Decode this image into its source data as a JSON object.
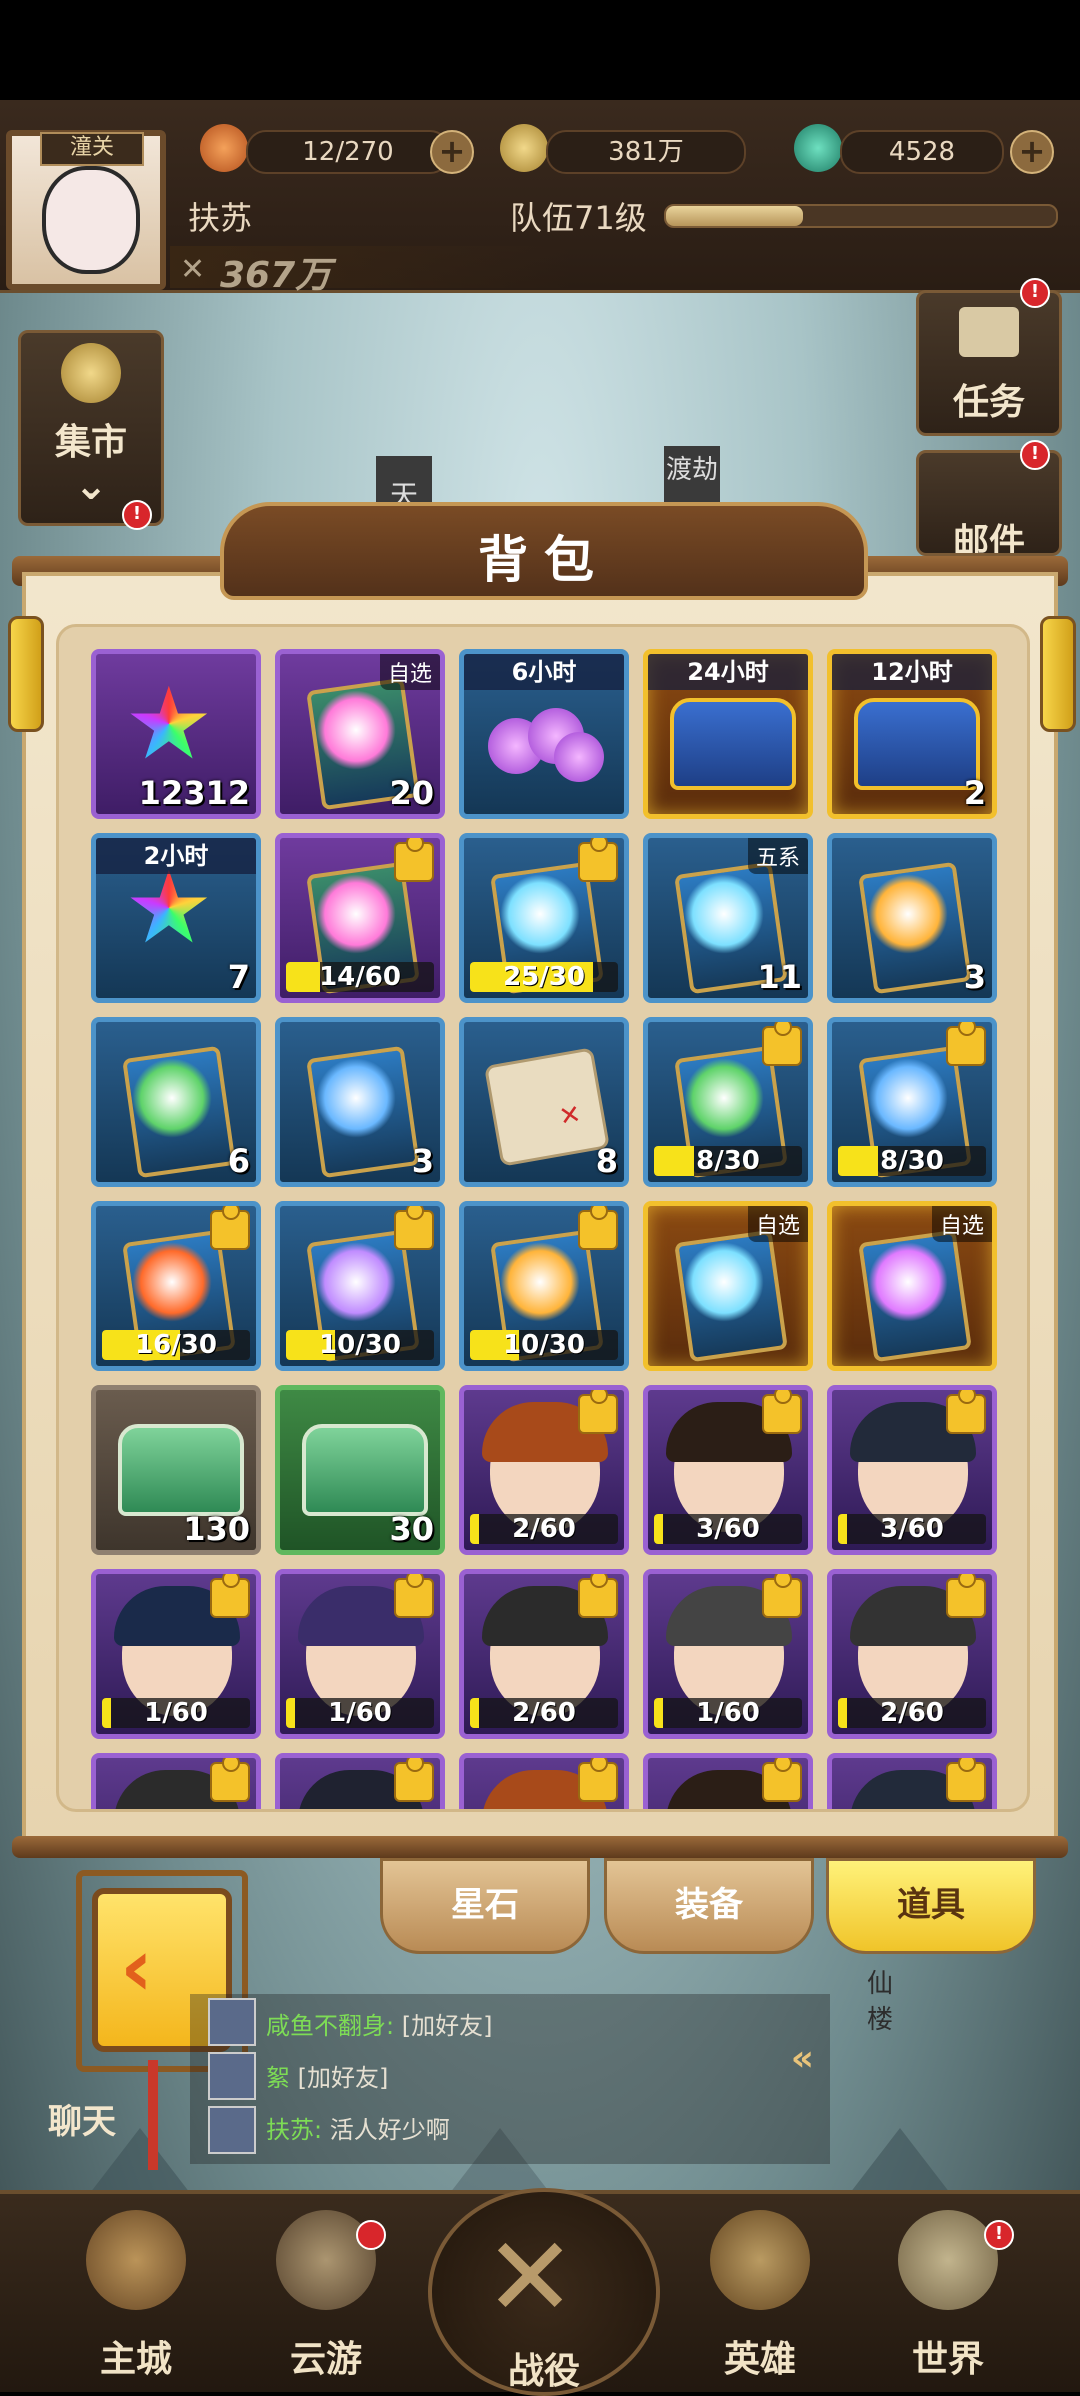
{
  "hud": {
    "avatar_tag": "潼关",
    "food": "12/270",
    "coins": "381万",
    "jade": "4528",
    "player_name": "扶苏",
    "team_level": "队伍71级",
    "team_level_progress": 0.35,
    "power": "367万"
  },
  "side": {
    "market": "集市",
    "task": "任务",
    "mail": "邮件",
    "sign_sky": "天",
    "sign_robbery": "渡劫",
    "tower": "仙楼"
  },
  "bag": {
    "title": "背包",
    "items": [
      {
        "quality": "purple",
        "kind": "star",
        "count": "12312"
      },
      {
        "quality": "purple",
        "kind": "card",
        "corner": "自选",
        "count": "20"
      },
      {
        "quality": "blue",
        "kind": "orbs",
        "band": "6小时"
      },
      {
        "quality": "gold",
        "kind": "chest",
        "band": "24小时"
      },
      {
        "quality": "gold",
        "kind": "bag",
        "band": "12小时",
        "count": "2"
      },
      {
        "quality": "blue",
        "kind": "star",
        "band": "2小时",
        "count": "7"
      },
      {
        "quality": "purple",
        "kind": "card-piece",
        "progress": "14/60",
        "fill": 0.233
      },
      {
        "quality": "blue",
        "kind": "card-piece",
        "progress": "25/30",
        "fill": 0.833
      },
      {
        "quality": "blue",
        "kind": "card",
        "corner": "五系",
        "count": "11"
      },
      {
        "quality": "blue",
        "kind": "card-gold",
        "count": "3"
      },
      {
        "quality": "blue",
        "kind": "card-green",
        "count": "6"
      },
      {
        "quality": "blue",
        "kind": "card-blue",
        "count": "3"
      },
      {
        "quality": "blue",
        "kind": "map",
        "count": "8"
      },
      {
        "quality": "blue",
        "kind": "card-piece-green",
        "progress": "8/30",
        "fill": 0.267
      },
      {
        "quality": "blue",
        "kind": "card-piece-blue",
        "progress": "8/30",
        "fill": 0.267
      },
      {
        "quality": "blue",
        "kind": "card-piece-fire",
        "progress": "16/30",
        "fill": 0.533
      },
      {
        "quality": "blue",
        "kind": "card-piece-moon",
        "progress": "10/30",
        "fill": 0.333
      },
      {
        "quality": "blue",
        "kind": "card-piece-sun",
        "progress": "10/30",
        "fill": 0.333
      },
      {
        "quality": "gold",
        "kind": "card",
        "corner": "自选"
      },
      {
        "quality": "gold",
        "kind": "card-purple",
        "corner": "自选"
      },
      {
        "quality": "gray",
        "kind": "chest-green",
        "count": "130"
      },
      {
        "quality": "green",
        "kind": "chest-green",
        "count": "30"
      },
      {
        "quality": "purple-chr",
        "kind": "hero",
        "progress": "2/60",
        "fill": 0.033
      },
      {
        "quality": "purple-chr",
        "kind": "hero",
        "progress": "3/60",
        "fill": 0.05
      },
      {
        "quality": "purple-chr",
        "kind": "hero",
        "progress": "3/60",
        "fill": 0.05
      },
      {
        "quality": "purple-chr",
        "kind": "hero",
        "progress": "1/60",
        "fill": 0.017
      },
      {
        "quality": "purple-chr",
        "kind": "hero",
        "progress": "1/60",
        "fill": 0.017
      },
      {
        "quality": "purple-chr",
        "kind": "hero",
        "progress": "2/60",
        "fill": 0.033
      },
      {
        "quality": "purple-chr",
        "kind": "hero",
        "progress": "1/60",
        "fill": 0.017
      },
      {
        "quality": "purple-chr",
        "kind": "hero",
        "progress": "2/60",
        "fill": 0.033
      },
      {
        "quality": "purple-chr",
        "kind": "hero"
      },
      {
        "quality": "purple-chr",
        "kind": "hero"
      },
      {
        "quality": "purple-chr",
        "kind": "hero"
      },
      {
        "quality": "purple-chr",
        "kind": "hero"
      },
      {
        "quality": "purple-chr",
        "kind": "hero"
      }
    ]
  },
  "tabs": [
    {
      "label": "星石",
      "active": false
    },
    {
      "label": "装备",
      "active": false
    },
    {
      "label": "道具",
      "active": true
    }
  ],
  "chat": {
    "button": "聊天",
    "messages": [
      {
        "name": "咸鱼不翻身:",
        "text": "[加好友]"
      },
      {
        "name": "絮",
        "text": "[加好友]"
      },
      {
        "name": "扶苏:",
        "text": "活人好少啊"
      }
    ]
  },
  "nav": {
    "main_city": "主城",
    "cloud_tour": "云游",
    "battle": "战役",
    "heroes": "英雄",
    "world": "世界"
  }
}
